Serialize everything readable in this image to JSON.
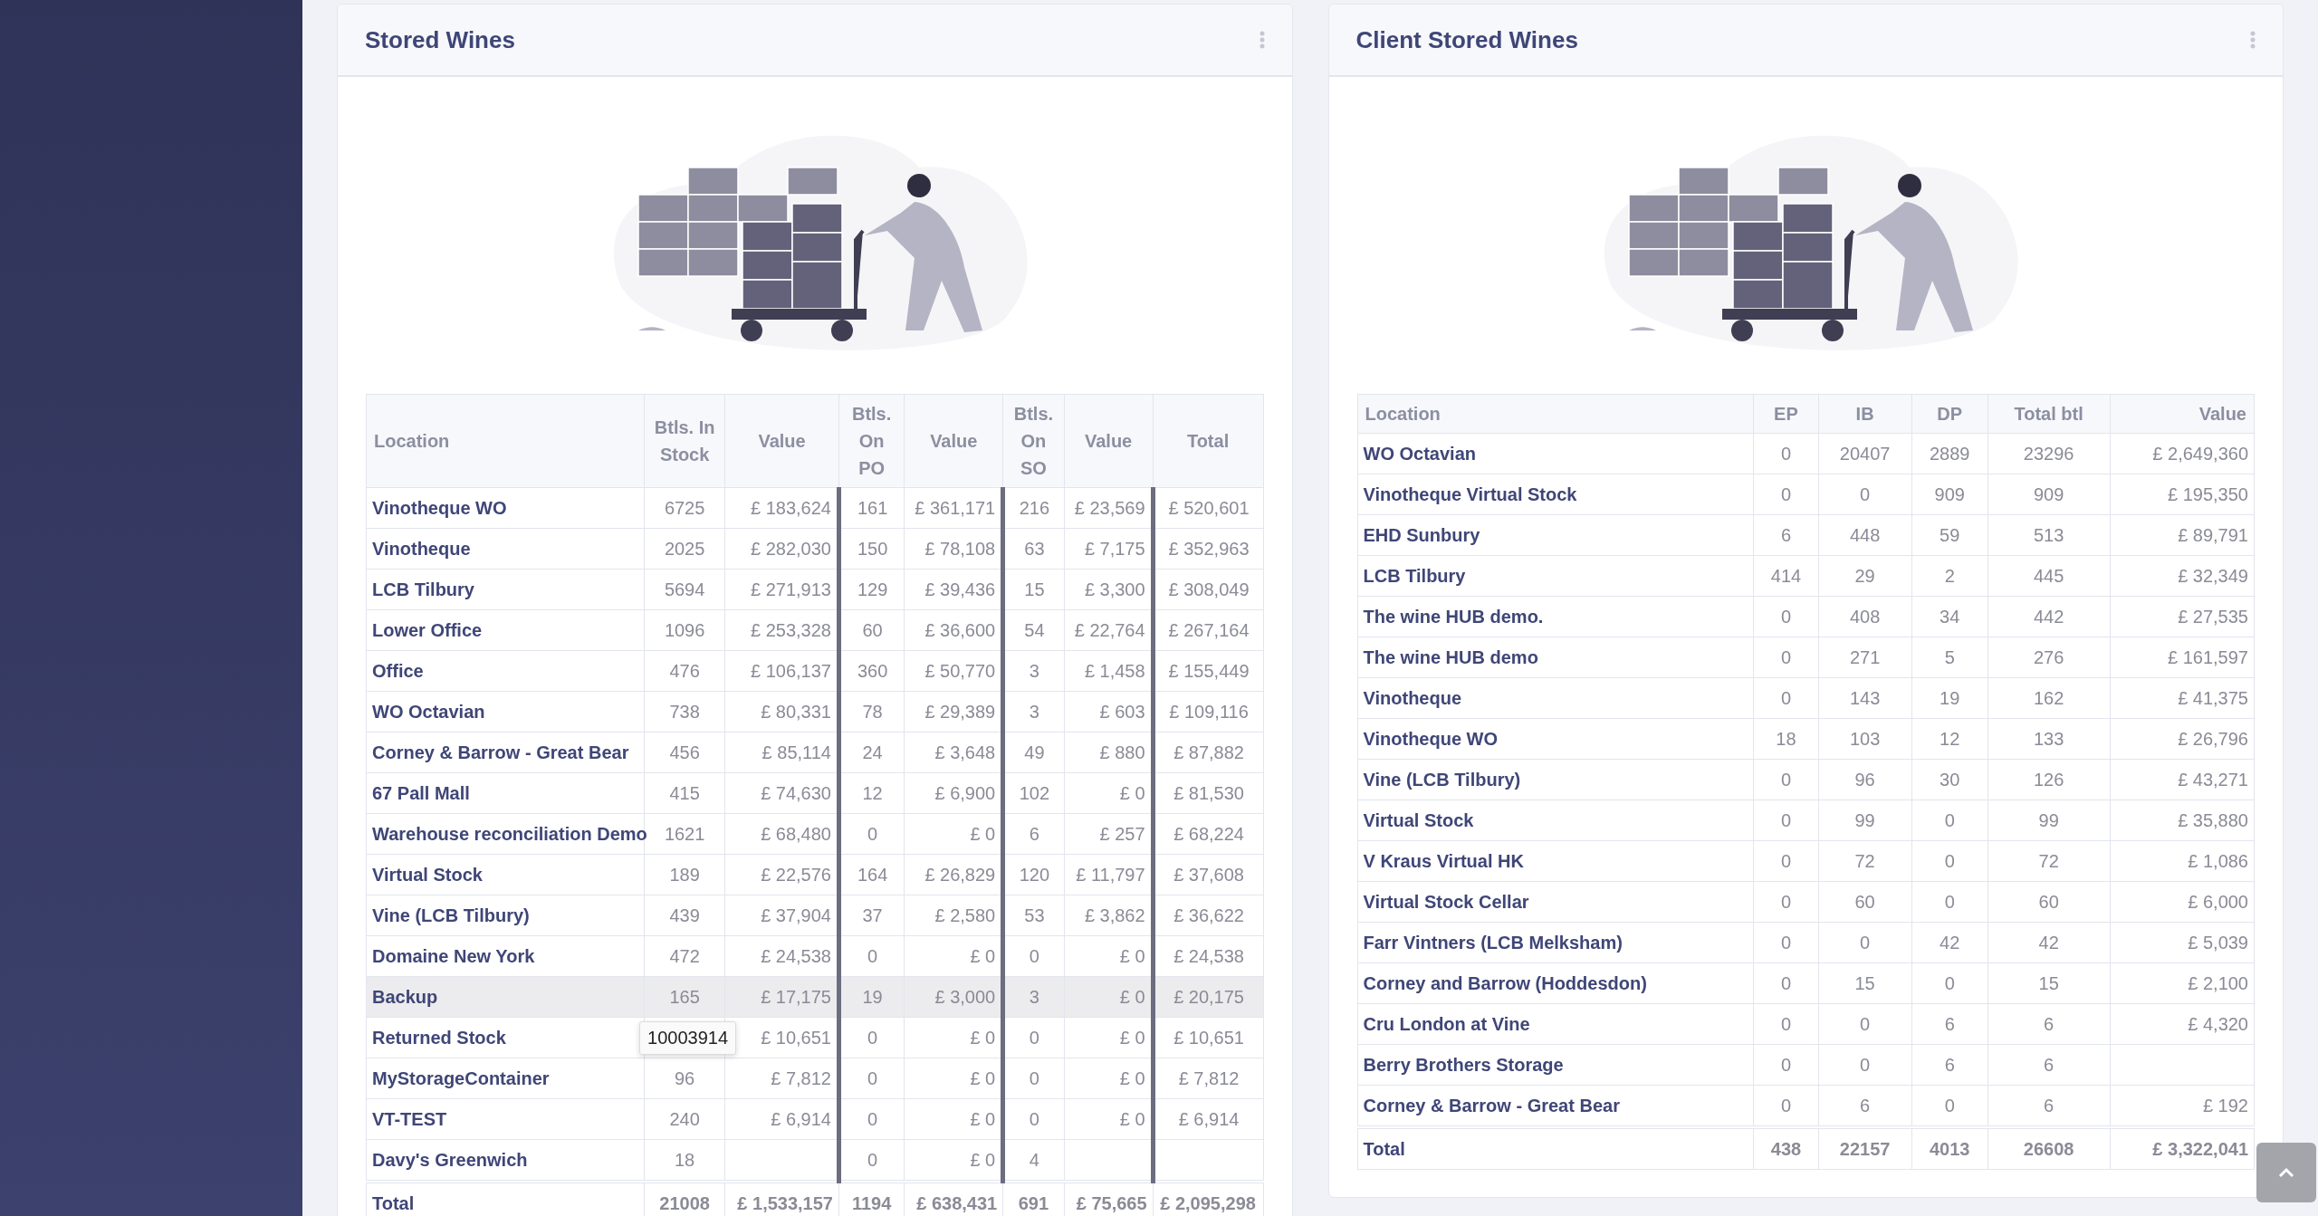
{
  "cards": [
    {
      "title": "Stored Wines",
      "kind": "stock",
      "columns": [
        "Location",
        "Btls. In Stock",
        "Value",
        "Btls. On PO",
        "Value",
        "Btls. On SO",
        "Value",
        "Total"
      ],
      "rows": [
        {
          "highlighted": false,
          "cells": [
            "Vinotheque WO",
            "6725",
            "£ 183,624",
            "161",
            "£ 361,171",
            "216",
            "£ 23,569",
            "£ 520,601"
          ]
        },
        {
          "highlighted": false,
          "cells": [
            "Vinotheque",
            "2025",
            "£ 282,030",
            "150",
            "£ 78,108",
            "63",
            "£ 7,175",
            "£ 352,963"
          ]
        },
        {
          "highlighted": false,
          "cells": [
            "LCB Tilbury",
            "5694",
            "£ 271,913",
            "129",
            "£ 39,436",
            "15",
            "£ 3,300",
            "£ 308,049"
          ]
        },
        {
          "highlighted": false,
          "cells": [
            "Lower Office",
            "1096",
            "£ 253,328",
            "60",
            "£ 36,600",
            "54",
            "£ 22,764",
            "£ 267,164"
          ]
        },
        {
          "highlighted": false,
          "cells": [
            "Office",
            "476",
            "£ 106,137",
            "360",
            "£ 50,770",
            "3",
            "£ 1,458",
            "£ 155,449"
          ]
        },
        {
          "highlighted": false,
          "cells": [
            "WO Octavian",
            "738",
            "£ 80,331",
            "78",
            "£ 29,389",
            "3",
            "£ 603",
            "£ 109,116"
          ]
        },
        {
          "highlighted": false,
          "cells": [
            "Corney & Barrow - Great Bear",
            "456",
            "£ 85,114",
            "24",
            "£ 3,648",
            "49",
            "£ 880",
            "£ 87,882"
          ]
        },
        {
          "highlighted": false,
          "cells": [
            "67 Pall Mall",
            "415",
            "£ 74,630",
            "12",
            "£ 6,900",
            "102",
            "£ 0",
            "£ 81,530"
          ]
        },
        {
          "highlighted": false,
          "cells": [
            "Warehouse reconciliation Demo",
            "1621",
            "£ 68,480",
            "0",
            "£ 0",
            "6",
            "£ 257",
            "£ 68,224"
          ]
        },
        {
          "highlighted": false,
          "cells": [
            "Virtual Stock",
            "189",
            "£ 22,576",
            "164",
            "£ 26,829",
            "120",
            "£ 11,797",
            "£ 37,608"
          ]
        },
        {
          "highlighted": false,
          "cells": [
            "Vine (LCB Tilbury)",
            "439",
            "£ 37,904",
            "37",
            "£ 2,580",
            "53",
            "£ 3,862",
            "£ 36,622"
          ]
        },
        {
          "highlighted": false,
          "cells": [
            "Domaine New York",
            "472",
            "£ 24,538",
            "0",
            "£ 0",
            "0",
            "£ 0",
            "£ 24,538"
          ]
        },
        {
          "highlighted": true,
          "cells": [
            "Backup",
            "165",
            "£ 17,175",
            "19",
            "£ 3,000",
            "3",
            "£ 0",
            "£ 20,175"
          ]
        },
        {
          "highlighted": false,
          "tooltip": "10003914",
          "cells": [
            "Returned Stock",
            null,
            "£ 10,651",
            "0",
            "£ 0",
            "0",
            "£ 0",
            "£ 10,651"
          ]
        },
        {
          "highlighted": false,
          "cells": [
            "MyStorageContainer",
            "96",
            "£ 7,812",
            "0",
            "£ 0",
            "0",
            "£ 0",
            "£ 7,812"
          ]
        },
        {
          "highlighted": false,
          "cells": [
            "VT-TEST",
            "240",
            "£ 6,914",
            "0",
            "£ 0",
            "0",
            "£ 0",
            "£ 6,914"
          ]
        },
        {
          "highlighted": false,
          "cells": [
            "Davy's Greenwich",
            "18",
            null,
            "0",
            "£ 0",
            "4",
            null,
            null
          ]
        }
      ],
      "total": [
        "Total",
        "21008",
        "£ 1,533,157",
        "1194",
        "£ 638,431",
        "691",
        "£ 75,665",
        "£ 2,095,298"
      ]
    },
    {
      "title": "Client Stored Wines",
      "kind": "client",
      "columns": [
        "Location",
        "EP",
        "IB",
        "DP",
        "Total btl",
        "Value"
      ],
      "rows": [
        {
          "cells": [
            "WO Octavian",
            "0",
            "20407",
            "2889",
            "23296",
            "£ 2,649,360"
          ]
        },
        {
          "cells": [
            "Vinotheque Virtual Stock",
            "0",
            "0",
            "909",
            "909",
            "£ 195,350"
          ]
        },
        {
          "cells": [
            "EHD Sunbury",
            "6",
            "448",
            "59",
            "513",
            "£ 89,791"
          ]
        },
        {
          "cells": [
            "LCB Tilbury",
            "414",
            "29",
            "2",
            "445",
            "£ 32,349"
          ]
        },
        {
          "cells": [
            "The wine HUB demo.",
            "0",
            "408",
            "34",
            "442",
            "£ 27,535"
          ]
        },
        {
          "cells": [
            "The wine HUB demo",
            "0",
            "271",
            "5",
            "276",
            "£ 161,597"
          ]
        },
        {
          "cells": [
            "Vinotheque",
            "0",
            "143",
            "19",
            "162",
            "£ 41,375"
          ]
        },
        {
          "cells": [
            "Vinotheque WO",
            "18",
            "103",
            "12",
            "133",
            "£ 26,796"
          ]
        },
        {
          "cells": [
            "Vine (LCB Tilbury)",
            "0",
            "96",
            "30",
            "126",
            "£ 43,271"
          ]
        },
        {
          "cells": [
            "Virtual Stock",
            "0",
            "99",
            "0",
            "99",
            "£ 35,880"
          ]
        },
        {
          "cells": [
            "V Kraus Virtual HK",
            "0",
            "72",
            "0",
            "72",
            "£ 1,086"
          ]
        },
        {
          "cells": [
            "Virtual Stock Cellar",
            "0",
            "60",
            "0",
            "60",
            "£ 6,000"
          ]
        },
        {
          "cells": [
            "Farr Vintners (LCB Melksham)",
            "0",
            "0",
            "42",
            "42",
            "£ 5,039"
          ]
        },
        {
          "cells": [
            "Corney and Barrow (Hoddesdon)",
            "0",
            "15",
            "0",
            "15",
            "£ 2,100"
          ]
        },
        {
          "cells": [
            "Cru London at Vine",
            "0",
            "0",
            "6",
            "6",
            "£ 4,320"
          ]
        },
        {
          "cells": [
            "Berry Brothers Storage",
            "0",
            "0",
            "6",
            "6",
            null
          ]
        },
        {
          "cells": [
            "Corney & Barrow - Great Bear",
            "0",
            "6",
            "0",
            "6",
            "£ 192"
          ]
        }
      ],
      "total": [
        "Total",
        "438",
        "22157",
        "4013",
        "26608",
        "£ 3,322,041"
      ]
    }
  ]
}
